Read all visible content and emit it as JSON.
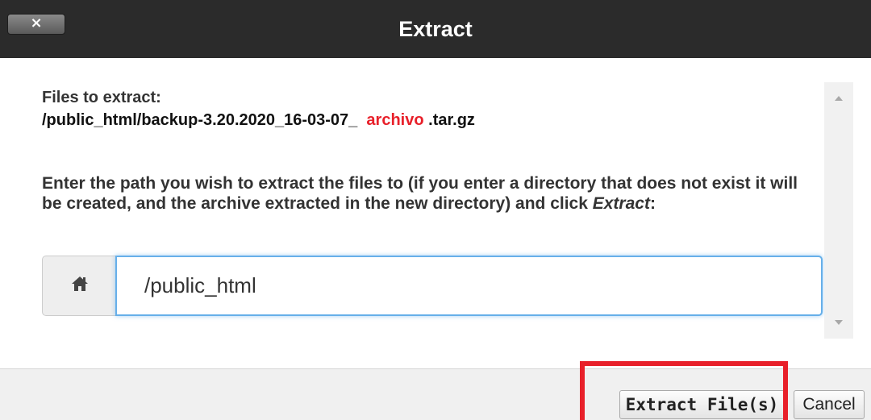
{
  "dialog": {
    "title": "Extract",
    "close_label": "×"
  },
  "content": {
    "files_label": "Files to extract:",
    "file_prefix": "/public_html/backup-3.20.2020_16-03-07_ ",
    "file_highlight": "archivo",
    "file_suffix": " .tar.gz",
    "instructions_text": "Enter the path you wish to extract the files to (if you enter a directory that does not exist it will be created, and the archive extracted in the new directory) and click ",
    "instructions_emphasis": "Extract",
    "instructions_end": ":",
    "path_value": "/public_html",
    "home_icon": "home-icon"
  },
  "footer": {
    "extract_label": "Extract File(s)",
    "cancel_label": "Cancel"
  },
  "colors": {
    "highlight_text": "#e8202a",
    "annotation_box": "#e8202a",
    "titlebar": "#2b2b2b",
    "input_focus": "#66afe9"
  }
}
